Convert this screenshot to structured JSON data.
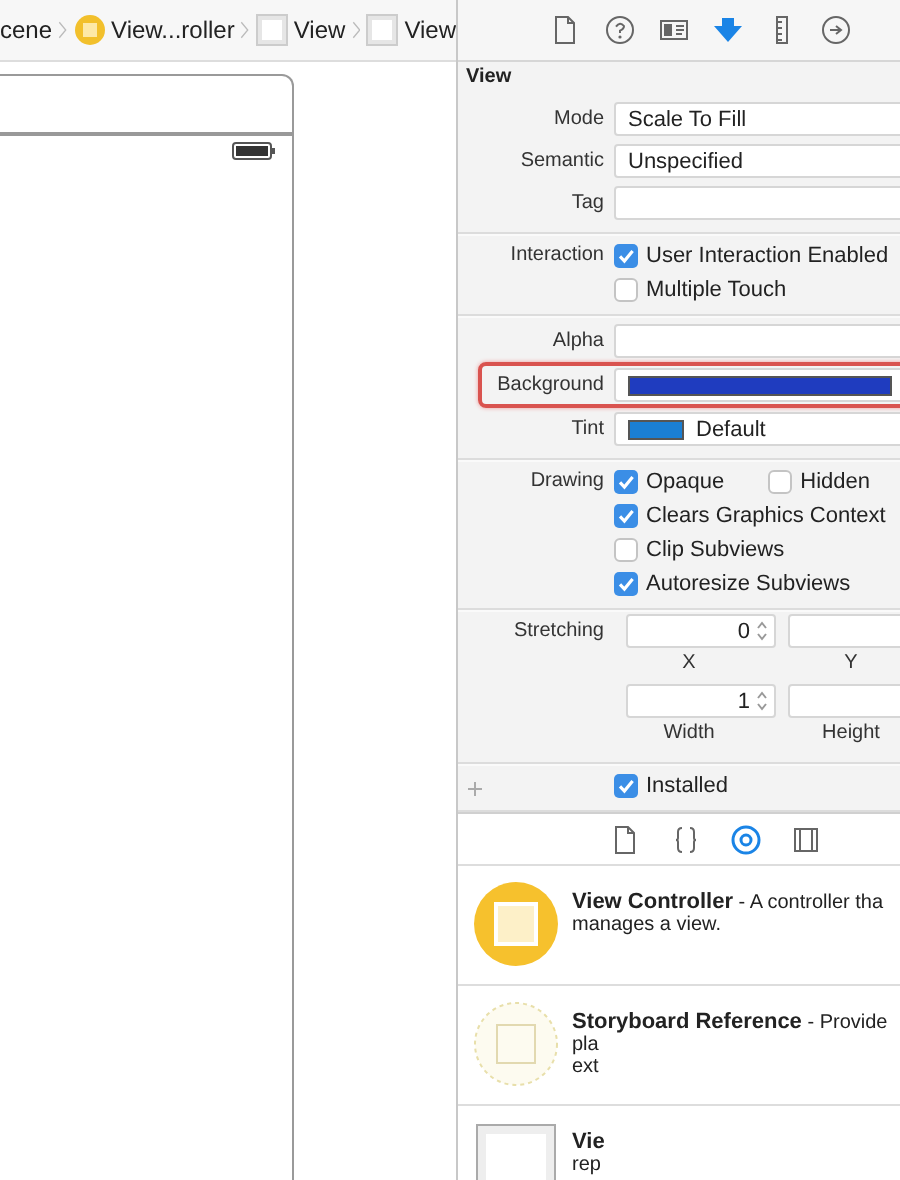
{
  "breadcrumb": [
    {
      "kind": "plain",
      "label": "cene"
    },
    {
      "kind": "controller",
      "label": "View...roller"
    },
    {
      "kind": "view",
      "label": "View"
    },
    {
      "kind": "view",
      "label": "View"
    }
  ],
  "inspector_tabs": [
    {
      "kind": "file",
      "selected": false
    },
    {
      "kind": "help",
      "selected": false
    },
    {
      "kind": "identity",
      "selected": false
    },
    {
      "kind": "attributes",
      "selected": true
    },
    {
      "kind": "size",
      "selected": false
    },
    {
      "kind": "connections",
      "selected": false
    }
  ],
  "section_title": "View",
  "sections": [
    {
      "rows": [
        {
          "kind": "popup",
          "label": "Mode",
          "value": "Scale To Fill"
        },
        {
          "kind": "popup",
          "label": "Semantic",
          "value": "Unspecified"
        },
        {
          "kind": "field",
          "label": "Tag"
        }
      ]
    },
    {
      "rows": [
        {
          "kind": "checks",
          "label": "Interaction",
          "items": [
            {
              "label": "User Interaction Enabled",
              "checked": true
            }
          ]
        },
        {
          "kind": "checks",
          "items": [
            {
              "label": "Multiple Touch",
              "checked": false
            }
          ]
        }
      ]
    },
    {
      "rows": [
        {
          "kind": "field",
          "label": "Alpha"
        },
        {
          "kind": "color",
          "label": "Background",
          "color": "#1f3cbf",
          "highlighted": true
        },
        {
          "kind": "color",
          "label": "Tint",
          "color": "#1a7fd4",
          "value": "Default",
          "highlighted": false
        }
      ]
    },
    {
      "rows": [
        {
          "kind": "checks",
          "label": "Drawing",
          "items": [
            {
              "label": "Opaque",
              "checked": true
            },
            {
              "label": "Hidden",
              "checked": false
            }
          ]
        },
        {
          "kind": "checks",
          "items": [
            {
              "label": "Clears Graphics Context",
              "checked": true
            }
          ]
        },
        {
          "kind": "checks",
          "items": [
            {
              "label": "Clip Subviews",
              "checked": false
            }
          ]
        },
        {
          "kind": "checks",
          "items": [
            {
              "label": "Autoresize Subviews",
              "checked": true
            }
          ]
        }
      ]
    },
    {
      "rows": [
        {
          "kind": "steppers",
          "label": "Stretching",
          "fields": [
            {
              "value": "0",
              "caption": "X"
            },
            {
              "caption": "Y"
            }
          ]
        },
        {
          "kind": "steppers",
          "fields": [
            {
              "value": "1",
              "caption": "Width"
            },
            {
              "caption": "Height"
            }
          ]
        }
      ]
    },
    {
      "rows": [
        {
          "kind": "checks",
          "add_icon": true,
          "items": [
            {
              "label": "Installed",
              "checked": true
            }
          ]
        }
      ]
    }
  ],
  "library_tabs": [
    {
      "kind": "file",
      "selected": false
    },
    {
      "kind": "braces",
      "selected": false
    },
    {
      "kind": "object",
      "selected": true
    },
    {
      "kind": "media",
      "selected": false
    }
  ],
  "library_items": [
    {
      "kind": "controller",
      "lines": [
        "**View Controller** - A controller tha",
        "manages a view."
      ]
    },
    {
      "kind": "reference",
      "lines": [
        "**Storyboard Reference** - Provide",
        "pla",
        "ext"
      ]
    },
    {
      "kind": "view",
      "lines": [
        "**Vie**",
        "rep"
      ]
    }
  ]
}
